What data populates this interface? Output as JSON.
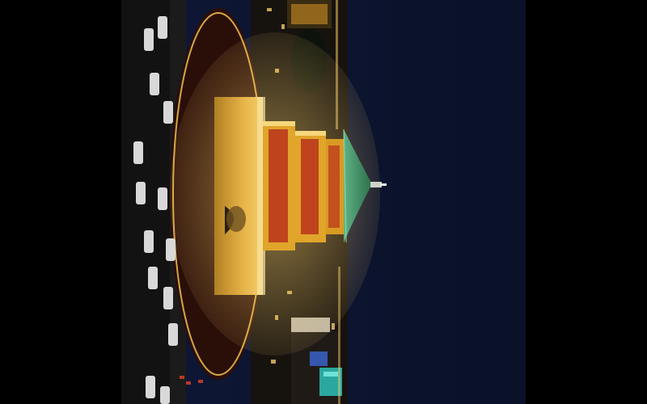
{
  "photo": {
    "subject": "tower-at-night",
    "orientation": "rotated",
    "colors": {
      "letterbox": "#000000",
      "sky": "#0b1430",
      "sky_edge": "#0e1736",
      "moat": "#241008",
      "platform": "#c89a3a",
      "platform_light": "#f2c24e",
      "tower_gold": "#e0a52a",
      "tower_red": "#b8321c",
      "roof_green": "#3d8c63",
      "street": "#141414",
      "car": "#d8d8d8",
      "city_light": "#ffd36e",
      "sign_teal": "#2aa8a0"
    }
  }
}
